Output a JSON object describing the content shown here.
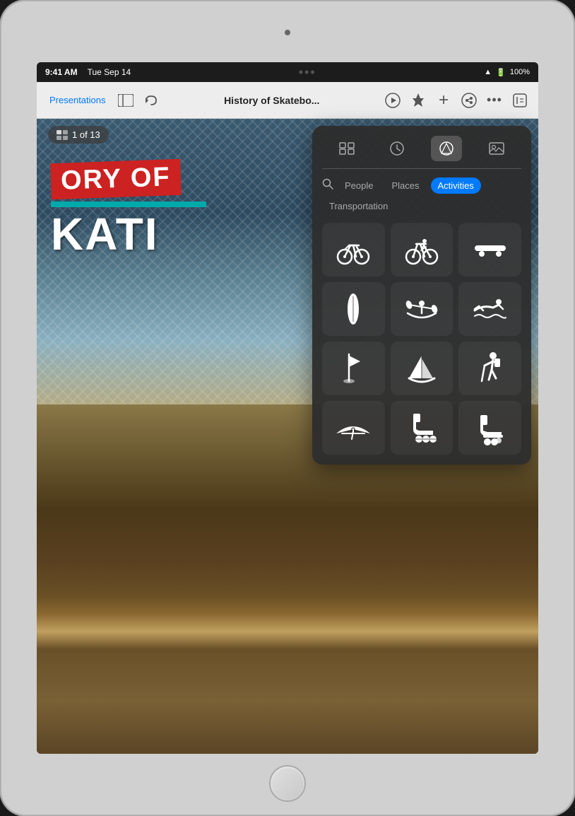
{
  "device": {
    "status_bar": {
      "time": "9:41 AM",
      "date": "Tue Sep 14",
      "wifi": "WiFi",
      "battery": "100%"
    }
  },
  "toolbar": {
    "back_label": "Presentations",
    "title": "History of Skatebo...",
    "dots_label": "•••"
  },
  "slide": {
    "counter": "1 of 13",
    "text_line1": "ORY OF",
    "text_line2": "KATI"
  },
  "symbol_panel": {
    "icon_tabs": [
      {
        "id": "grid",
        "label": "Grid"
      },
      {
        "id": "recent",
        "label": "Recent"
      },
      {
        "id": "shapes",
        "label": "Shapes"
      },
      {
        "id": "photos",
        "label": "Photos"
      }
    ],
    "categories": [
      {
        "id": "people",
        "label": "People",
        "active": false
      },
      {
        "id": "places",
        "label": "Places",
        "active": false
      },
      {
        "id": "activities",
        "label": "Activities",
        "active": true
      },
      {
        "id": "transportation",
        "label": "Transportation",
        "active": false
      }
    ],
    "symbols": [
      {
        "id": "bicycle",
        "label": "Bicycle",
        "unicode": "🚲"
      },
      {
        "id": "mountain-bike",
        "label": "Mountain Bike",
        "unicode": "🚵"
      },
      {
        "id": "skateboard",
        "label": "Skateboard",
        "unicode": "🛹"
      },
      {
        "id": "surfboard",
        "label": "Surfboard",
        "unicode": "🏄"
      },
      {
        "id": "rowing",
        "label": "Rowing",
        "unicode": "🚣"
      },
      {
        "id": "swimming",
        "label": "Swimming",
        "unicode": "🏊"
      },
      {
        "id": "golf",
        "label": "Golf",
        "unicode": "⛳"
      },
      {
        "id": "sailing",
        "label": "Sailing",
        "unicode": "⛵"
      },
      {
        "id": "hiking",
        "label": "Hiking",
        "unicode": "🥾"
      },
      {
        "id": "hang-gliding",
        "label": "Hang Gliding",
        "unicode": "🪂"
      },
      {
        "id": "inline-skate",
        "label": "Inline Skate",
        "unicode": "🛼"
      },
      {
        "id": "roller-skate",
        "label": "Roller Skate",
        "unicode": "🛼"
      }
    ]
  }
}
